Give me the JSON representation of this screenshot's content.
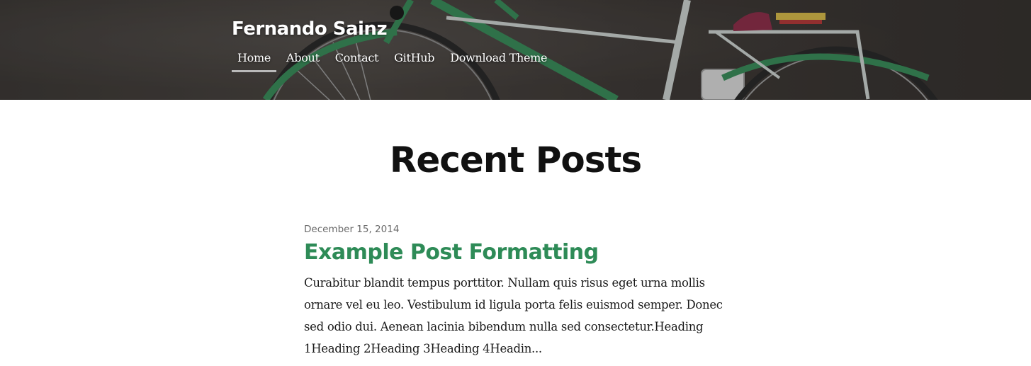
{
  "header": {
    "site_title": "Fernando Sainz",
    "nav": [
      {
        "label": "Home",
        "active": true
      },
      {
        "label": "About",
        "active": false
      },
      {
        "label": "Contact",
        "active": false
      },
      {
        "label": "GitHub",
        "active": false
      },
      {
        "label": "Download Theme",
        "active": false
      }
    ],
    "background_image": "bicycle-photo"
  },
  "main": {
    "heading": "Recent Posts",
    "posts": [
      {
        "date": "December 15, 2014",
        "title": "Example Post Formatting",
        "excerpt": "Curabitur blandit tempus porttitor. Nullam quis risus eget urna mollis ornare vel eu leo. Vestibulum id ligula porta felis euismod semper. Donec sed odio dui. Aenean lacinia bibendum nulla sed consectetur.Heading 1Heading 2Heading 3Heading 4Headin..."
      }
    ]
  },
  "colors": {
    "accent": "#2e8b57",
    "bike_frame": "#3a8a5a",
    "nav_underline": "#b9b9b9"
  }
}
